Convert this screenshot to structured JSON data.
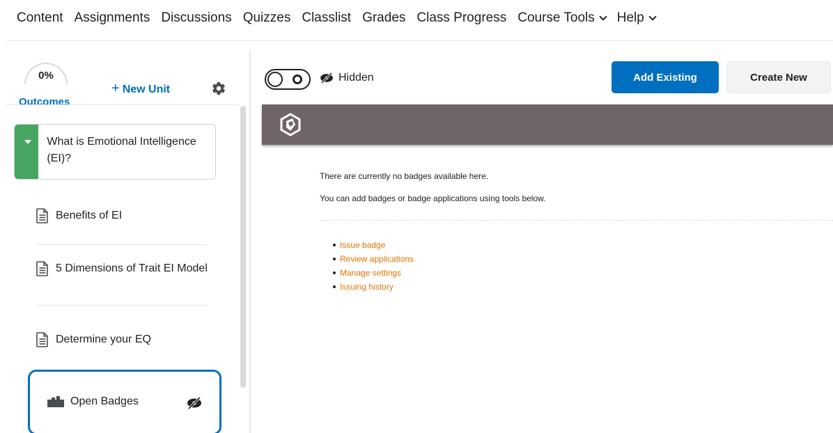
{
  "topnav": {
    "items": [
      {
        "label": "Content"
      },
      {
        "label": "Assignments"
      },
      {
        "label": "Discussions"
      },
      {
        "label": "Quizzes"
      },
      {
        "label": "Classlist"
      },
      {
        "label": "Grades"
      },
      {
        "label": "Class Progress"
      },
      {
        "label": "Course Tools"
      },
      {
        "label": "Help"
      }
    ]
  },
  "sidebar": {
    "outcomes_percent": "0%",
    "outcomes_label": "Outcomes",
    "new_unit_label": "New Unit",
    "unit_title": "What is Emotional Intelligence (EI)?",
    "topics": [
      {
        "label": "Benefits of EI",
        "icon": "document-icon"
      },
      {
        "label": "5 Dimensions of Trait EI Model",
        "icon": "document-icon"
      },
      {
        "label": "Determine your EQ",
        "icon": "document-icon"
      }
    ],
    "selected_topic": {
      "label": "Open Badges",
      "icon": "badge-icon",
      "status_icon": "hidden-eye-icon"
    }
  },
  "main": {
    "visibility_label": "Hidden",
    "add_existing_label": "Add Existing",
    "create_new_label": "Create New",
    "message_1": "There are currently no badges available here.",
    "message_2": "You can add badges or badge applications using tools below.",
    "links": [
      {
        "label": "Issue badge"
      },
      {
        "label": "Review applications"
      },
      {
        "label": "Manage settings"
      },
      {
        "label": "Issuing history"
      }
    ]
  },
  "colors": {
    "accent": "#006fbf",
    "unit_marker": "#46a661",
    "banner": "#706566",
    "link": "#e17300"
  }
}
